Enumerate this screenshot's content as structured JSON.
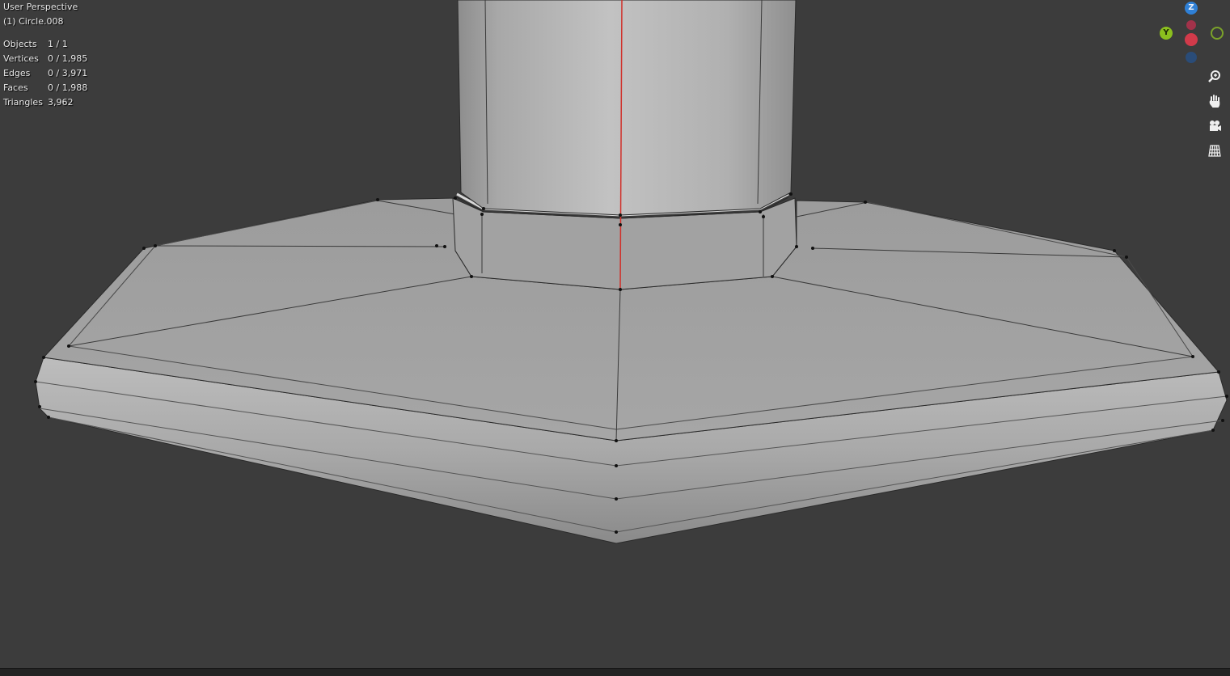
{
  "viewport": {
    "view_name": "User Perspective",
    "object_name": "(1) Circle.008"
  },
  "stats": [
    {
      "label": "Objects",
      "value": "1 / 1"
    },
    {
      "label": "Vertices",
      "value": "0 / 1,985"
    },
    {
      "label": "Edges",
      "value": "0 / 3,971"
    },
    {
      "label": "Faces",
      "value": "0 / 1,988"
    },
    {
      "label": "Triangles",
      "value": "3,962"
    }
  ],
  "gizmo": {
    "z_label": "Z",
    "y_label": "Y"
  },
  "toolbar": {
    "buttons": [
      "zoom-icon",
      "hand-pan-icon",
      "camera-icon",
      "grid-icon"
    ]
  },
  "colors": {
    "background": "#3c3c3c",
    "mesh": "#a8a8a8",
    "axis_line": "#d0302a"
  }
}
